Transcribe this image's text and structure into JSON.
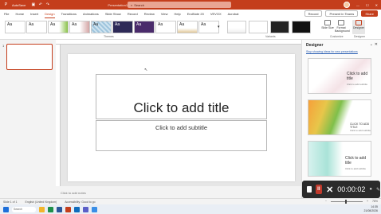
{
  "titlebar": {
    "autosave": "AutoSave",
    "doc_title": "Presentation1 - PowerPoint",
    "search_placeholder": "Search",
    "colors": {
      "bar": "#c43e1c"
    }
  },
  "menu": {
    "items": [
      "File",
      "Home",
      "Insert",
      "Design",
      "Transitions",
      "Animations",
      "Slide Show",
      "Record",
      "Review",
      "View",
      "Help",
      "EndNote 20",
      "VEVOX",
      "Acrobat"
    ],
    "active": "Design",
    "record": "Record",
    "present": "Present in Teams",
    "share": "Share"
  },
  "ribbon": {
    "themes": [
      "Aa",
      "Aa",
      "Aa",
      "Aa",
      "Aa",
      "Aa",
      "Aa",
      "Aa",
      "Aa",
      "Aa"
    ],
    "themes_label": "Themes",
    "variants_label": "Variants",
    "slide_size": "Slide Size",
    "format_background": "Format Background",
    "designer": "Designer",
    "customize_label": "Customize",
    "designer_label": "Designer"
  },
  "thumbs": {
    "number": "1"
  },
  "slide": {
    "title_placeholder": "Click to add title",
    "subtitle_placeholder": "Click to add subtitle"
  },
  "notes": "Click to add notes",
  "designer_pane": {
    "title": "Designer",
    "link": "Stop showing ideas for new presentations",
    "designs": [
      {
        "title": "Click to add title",
        "sub": "Click to add subtitle"
      },
      {
        "title": "CLICK TO ADD TITLE",
        "sub": "Click to add subtitle"
      },
      {
        "title": "Click to add title",
        "sub": "Click to add subtitle"
      }
    ]
  },
  "recorder": {
    "time": "00:00:02"
  },
  "status": {
    "slide": "Slide 1 of 1",
    "language": "English (United Kingdom)",
    "accessibility": "Accessibility: Good to go",
    "zoom": "76%"
  },
  "taskbar": {
    "search": "Search",
    "time": "14:35",
    "date": "21/08/2026"
  }
}
